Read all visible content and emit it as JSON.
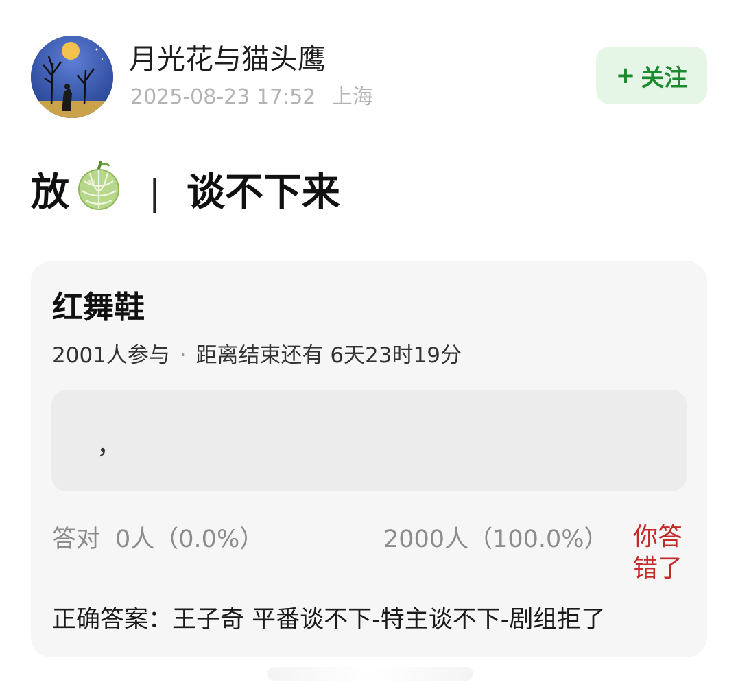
{
  "author": {
    "name": "月光花与猫头鹰",
    "timestamp": "2025-08-23 17:52",
    "location": "上海",
    "avatar_icon": "moon-tree-avatar"
  },
  "follow_button": {
    "plus": "+",
    "label": "关注",
    "bg_color": "#e6f6e6",
    "text_color": "#1d8a2f"
  },
  "post": {
    "title_prefix": "放",
    "emoji_icon": "melon-icon",
    "separator": "|",
    "title_suffix": "谈不下来"
  },
  "quiz": {
    "title": "红舞鞋",
    "participants": "2001人参与",
    "dot": "·",
    "countdown": "距离结束还有 6天23时19分",
    "answer_input": "，",
    "correct_label": "答对",
    "correct_value": "0人（0.0%）",
    "wrong_value": "2000人（100.0%）",
    "wrong_tag": "你答错了",
    "wrong_color": "#c42a2a",
    "correct_answer": "正确答案：王子奇 平番谈不下-特主谈不下-剧组拒了"
  }
}
